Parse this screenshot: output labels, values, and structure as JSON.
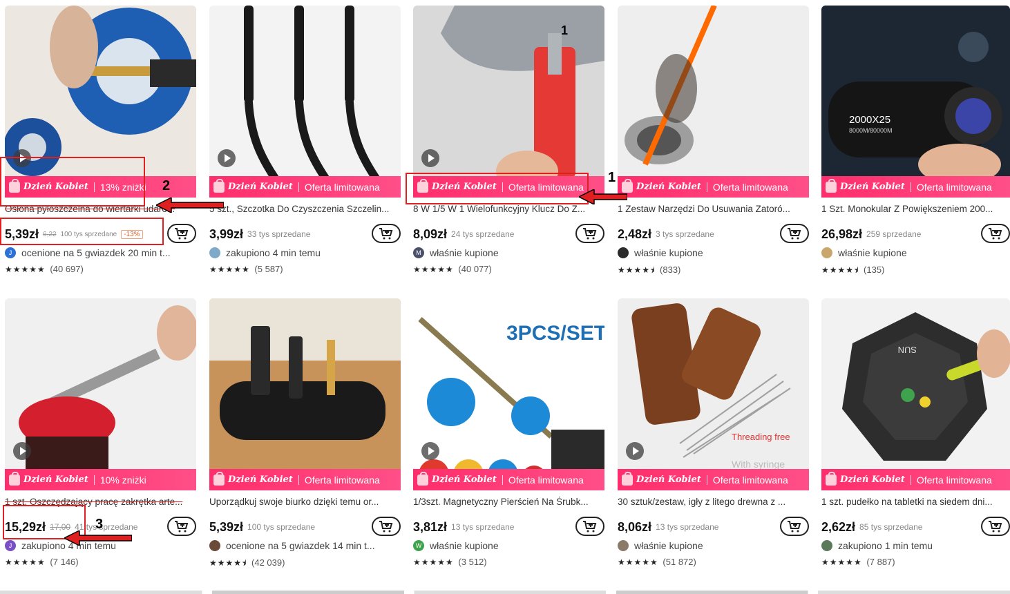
{
  "products": [
    {
      "title": "Osłona pyłoszczelna do wiertarki udaro...",
      "price": "5,39zł",
      "old_price": "6,22",
      "sold": "100 tys sprzedane",
      "discount_badge": "-13%",
      "promo_tag": "Dzień Kobiet",
      "promo_text": "13% zniżki",
      "buyer_avatar": "J",
      "buyer_text": "ocenione na 5 gwiazdek 20 min t...",
      "stars": "★★★★★",
      "rating_count": "(40 697)",
      "has_video": true
    },
    {
      "title": "5 szt., Szczotka Do Czyszczenia Szczelin...",
      "price": "3,99zł",
      "old_price": "",
      "sold": "33 tys sprzedane",
      "discount_badge": "",
      "promo_tag": "Dzień Kobiet",
      "promo_text": "Oferta limitowana",
      "buyer_avatar": "",
      "buyer_text": "zakupiono 4 min temu",
      "stars": "★★★★★",
      "rating_count": "(5 587)",
      "has_video": true
    },
    {
      "title": "8 W 1/5 W 1 Wielofunkcyjny Klucz Do Z...",
      "price": "8,09zł",
      "old_price": "",
      "sold": "24 tys sprzedane",
      "discount_badge": "",
      "promo_tag": "Dzień Kobiet",
      "promo_text": "Oferta limitowana",
      "buyer_avatar": "M",
      "buyer_text": "właśnie kupione",
      "stars": "★★★★★",
      "rating_count": "(40 077)",
      "has_video": true
    },
    {
      "title": "1 Zestaw Narzędzi Do Usuwania Zatoró...",
      "price": "2,48zł",
      "old_price": "",
      "sold": "3 tys sprzedane",
      "discount_badge": "",
      "promo_tag": "Dzień Kobiet",
      "promo_text": "Oferta limitowana",
      "buyer_avatar": "",
      "buyer_text": "właśnie kupione",
      "stars": "★★★★⯨",
      "rating_count": "(833)",
      "has_video": false
    },
    {
      "title": "1 Szt. Monokular Z Powiększeniem 200...",
      "price": "26,98zł",
      "old_price": "",
      "sold": "259 sprzedane",
      "discount_badge": "",
      "promo_tag": "Dzień Kobiet",
      "promo_text": "Oferta limitowana",
      "buyer_avatar": "",
      "buyer_text": "właśnie kupione",
      "stars": "★★★★⯨",
      "rating_count": "(135)",
      "has_video": false
    },
    {
      "title": "1 szt. Oszczędzający pracę zakrętka arte...",
      "price": "15,29zł",
      "old_price": "17,00",
      "sold": "41 tys sprzedane",
      "discount_badge": "",
      "promo_tag": "Dzień Kobiet",
      "promo_text": "10% zniżki",
      "buyer_avatar": "J",
      "buyer_text": "zakupiono 4 min temu",
      "stars": "★★★★★",
      "rating_count": "(7 146)",
      "has_video": true
    },
    {
      "title": "Uporządkuj swoje biurko dzięki temu or...",
      "price": "5,39zł",
      "old_price": "",
      "sold": "100 tys sprzedane",
      "discount_badge": "",
      "promo_tag": "Dzień Kobiet",
      "promo_text": "Oferta limitowana",
      "buyer_avatar": "",
      "buyer_text": "ocenione na 5 gwiazdek 14 min t...",
      "stars": "★★★★⯨",
      "rating_count": "(42 039)",
      "has_video": false
    },
    {
      "title": "1/3szt. Magnetyczny Pierścień Na Śrubk...",
      "price": "3,81zł",
      "old_price": "",
      "sold": "13 tys sprzedane",
      "discount_badge": "",
      "promo_tag": "Dzień Kobiet",
      "promo_text": "Oferta limitowana",
      "buyer_avatar": "W",
      "buyer_text": "właśnie kupione",
      "stars": "★★★★★",
      "rating_count": "(3 512)",
      "has_video": true,
      "image_text": "3PCS/SET"
    },
    {
      "title": "30 sztuk/zestaw, igły z litego drewna z ...",
      "price": "8,06zł",
      "old_price": "",
      "sold": "13 tys sprzedane",
      "discount_badge": "",
      "promo_tag": "Dzień Kobiet",
      "promo_text": "Oferta limitowana",
      "buyer_avatar": "",
      "buyer_text": "właśnie kupione",
      "stars": "★★★★★",
      "rating_count": "(51 872)",
      "has_video": true,
      "image_text": "Threading free",
      "image_text2": "With syringe"
    },
    {
      "title": "1 szt. pudełko na tabletki na siedem dni...",
      "price": "2,62zł",
      "old_price": "",
      "sold": "85 tys sprzedane",
      "discount_badge": "",
      "promo_tag": "Dzień Kobiet",
      "promo_text": "Oferta limitowana",
      "buyer_avatar": "",
      "buyer_text": "zakupiono 1 min temu",
      "stars": "★★★★★",
      "rating_count": "(7 887)",
      "has_video": false,
      "image_text": "SUN"
    }
  ],
  "monocular_label": "2000X25",
  "monocular_sublabel": "8000M/80000M",
  "annotations": {
    "n1a": "1",
    "n1b": "1",
    "n2": "2",
    "n3": "3"
  },
  "colors": {
    "promo": "#ff2d6b",
    "annotation": "#e02020"
  }
}
